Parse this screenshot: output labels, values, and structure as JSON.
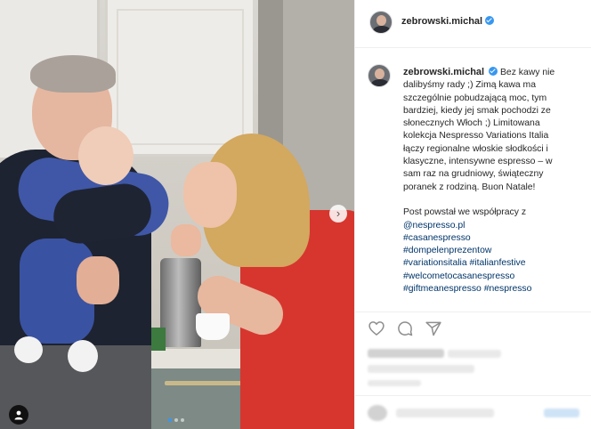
{
  "post": {
    "username": "zebrowski.michal",
    "verified": true,
    "accent_color": "#3897f0",
    "hashtag_color": "#003569",
    "caption_lines": [
      "Bez kawy nie",
      "dalibyśmy rady ;) Zimą kawa ma",
      "szczególnie pobudzającą moc, tym",
      "bardziej, kiedy jej smak pochodzi ze",
      "słonecznych Włoch ;) Limitowana",
      "kolekcja Nespresso Variations Italia",
      "łączy regionalne włoskie słodkości i",
      "klasyczne, intensywne espresso – w",
      "sam raz na grudniowy, świąteczny",
      "poranek z rodziną. Buon Natale!"
    ],
    "collab_line": "Post powstał we współpracy z",
    "mention": "@nespresso.pl",
    "hashtag_lines": [
      [
        "#casanespresso"
      ],
      [
        "#dompelenprezentow"
      ],
      [
        "#variationsitalia",
        "#italianfestive"
      ],
      [
        "#welcometocasanespresso"
      ],
      [
        "#giftmeanespresso",
        "#nespresso"
      ]
    ]
  },
  "media": {
    "carousel_dots": 3,
    "active_dot": 0,
    "next_symbol": "›"
  },
  "icons": {
    "like": "heart-icon",
    "comment": "comment-icon",
    "share": "share-icon",
    "next": "chevron-right-icon",
    "tags": "user-tag-icon",
    "verified": "verified-badge-icon"
  }
}
